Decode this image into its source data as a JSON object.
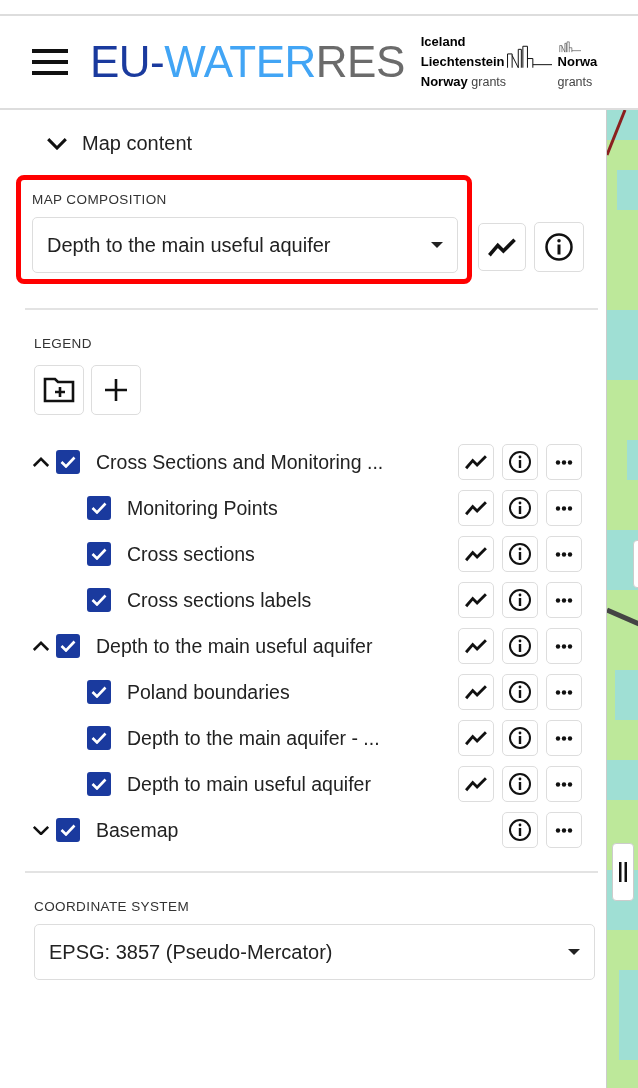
{
  "header": {
    "title_parts": [
      {
        "text": "EU-",
        "color": "#1a3a9e"
      },
      {
        "text": "WATER",
        "color": "#42a5f5"
      },
      {
        "text": "RES",
        "color": "#6b6b6b"
      }
    ],
    "logos": [
      {
        "lines": [
          "Iceland",
          "Liechtenstein"
        ],
        "country": "Norway",
        "suffix": "grants"
      },
      {
        "country": "Norwa",
        "suffix": "grants"
      }
    ]
  },
  "map_content": {
    "label": "Map content",
    "expanded": true
  },
  "map_composition": {
    "label": "MAP COMPOSITION",
    "value": "Depth to the main useful aquifer",
    "highlighted": true
  },
  "legend": {
    "label": "LEGEND",
    "items": [
      {
        "label": "Cross Sections and Monitoring ...",
        "checked": true,
        "expanded": true,
        "chart_button": true,
        "children": [
          {
            "label": "Monitoring Points",
            "checked": true,
            "chart_button": true
          },
          {
            "label": "Cross sections",
            "checked": true,
            "chart_button": true
          },
          {
            "label": "Cross sections labels",
            "checked": true,
            "chart_button": true
          }
        ]
      },
      {
        "label": "Depth to the main useful aquifer",
        "checked": true,
        "expanded": true,
        "chart_button": true,
        "children": [
          {
            "label": "Poland boundaries",
            "checked": true,
            "chart_button": true
          },
          {
            "label": "Depth to the main aquifer - ...",
            "checked": true,
            "chart_button": true
          },
          {
            "label": "Depth to main useful aquifer",
            "checked": true,
            "chart_button": true
          }
        ]
      },
      {
        "label": "Basemap",
        "checked": true,
        "expanded": false,
        "chart_button": false
      }
    ]
  },
  "coordinate_system": {
    "label": "COORDINATE SYSTEM",
    "value": "EPSG: 3857 (Pseudo-Mercator)"
  }
}
